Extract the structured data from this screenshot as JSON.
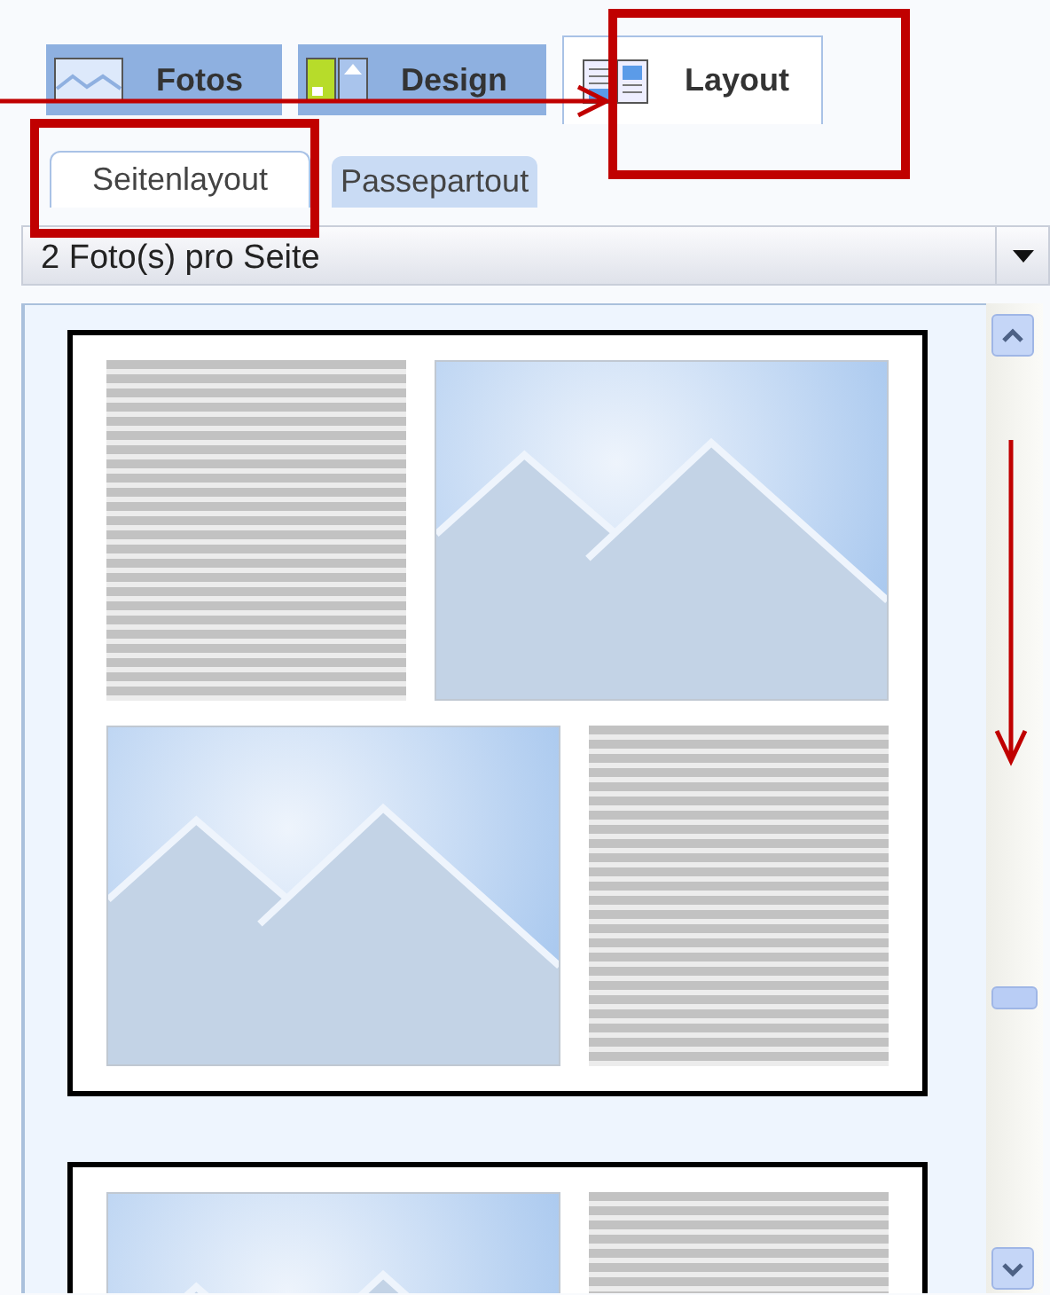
{
  "tabs": [
    {
      "kind": "photos",
      "label": "Fotos",
      "selected": false
    },
    {
      "kind": "design",
      "label": "Design",
      "selected": false
    },
    {
      "kind": "layout",
      "label": "Layout",
      "selected": true
    }
  ],
  "subtabs": [
    {
      "label": "Seitenlayout",
      "selected": true
    },
    {
      "label": "Passepartout",
      "selected": false
    }
  ],
  "dropdown": {
    "value": "2 Foto(s) pro Seite"
  },
  "layouts": [
    {
      "rows": [
        [
          {
            "kind": "text"
          },
          {
            "kind": "photo"
          }
        ],
        [
          {
            "kind": "photo"
          },
          {
            "kind": "text"
          }
        ]
      ]
    },
    {
      "rows": [
        [
          {
            "kind": "photo"
          },
          {
            "kind": "text"
          }
        ]
      ]
    }
  ]
}
